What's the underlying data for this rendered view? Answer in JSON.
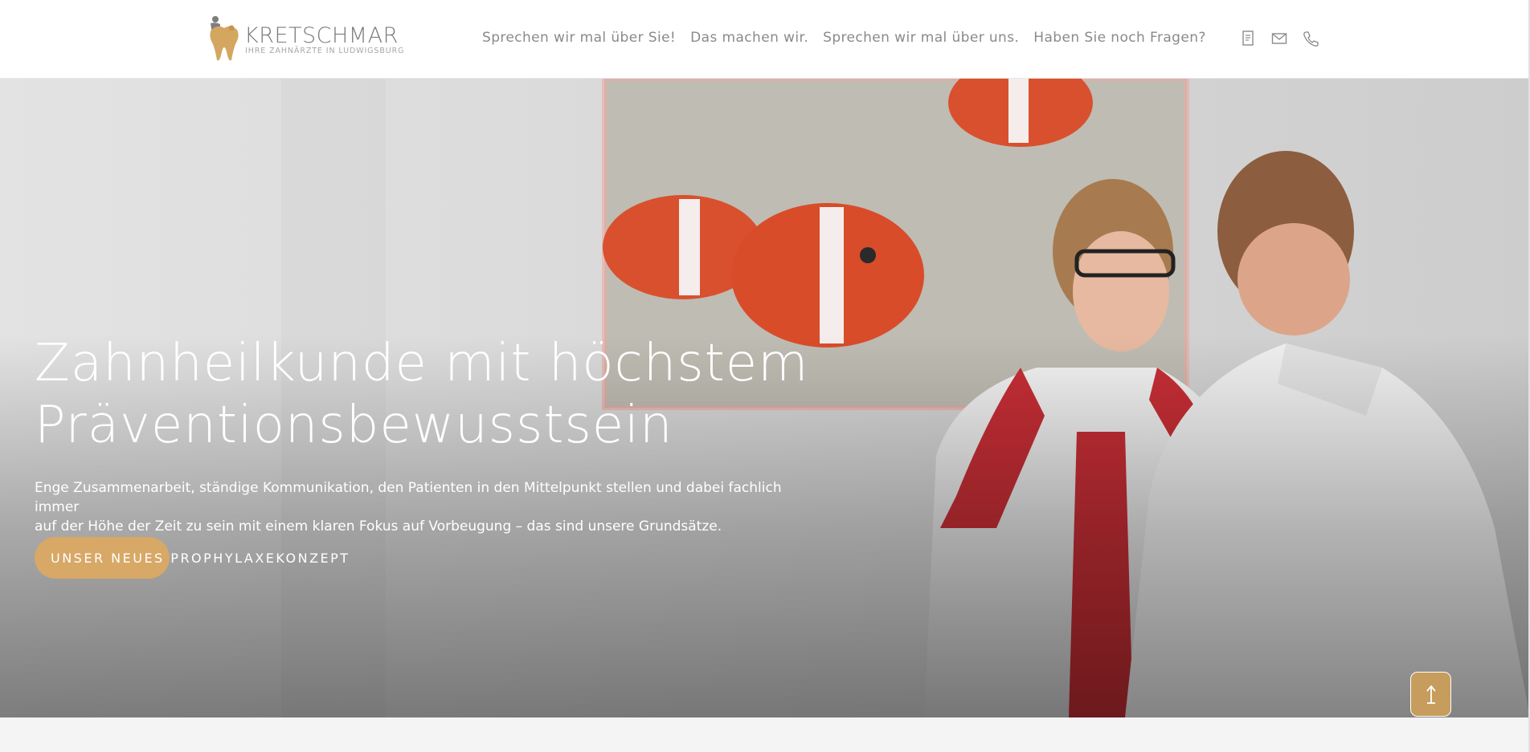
{
  "brand": {
    "name": "KRETSCHMAR",
    "tagline": "IHRE ZAHNÄRZTE IN LUDWIGSBURG",
    "logo_icon": "tooth-logo-icon",
    "accent_color": "#d7a866"
  },
  "nav": {
    "items": [
      {
        "label": "Sprechen wir mal über Sie!"
      },
      {
        "label": "Das machen wir."
      },
      {
        "label": "Sprechen wir mal über uns."
      },
      {
        "label": "Haben Sie noch Fragen?"
      }
    ],
    "icons": [
      "document-icon",
      "mail-icon",
      "phone-icon"
    ]
  },
  "hero": {
    "title_line1": "Zahnheilkunde mit höchstem",
    "title_line2": "Präventionsbewusstsein",
    "text_line1": "Enge Zusammenarbeit, ständige Kommunikation, den Patienten in den Mittelpunkt stellen und dabei fachlich immer",
    "text_line2": "auf der Höhe der Zeit zu sein mit einem klaren Fokus auf Vorbeugung – das sind unsere Grundsätze.",
    "cta_label": "UNSER NEUES PROPHYLAXEKONZEPT",
    "image_subject": "hero-photo-dentist-and-patient"
  },
  "scroll_top": {
    "icon": "arrow-up-icon"
  }
}
